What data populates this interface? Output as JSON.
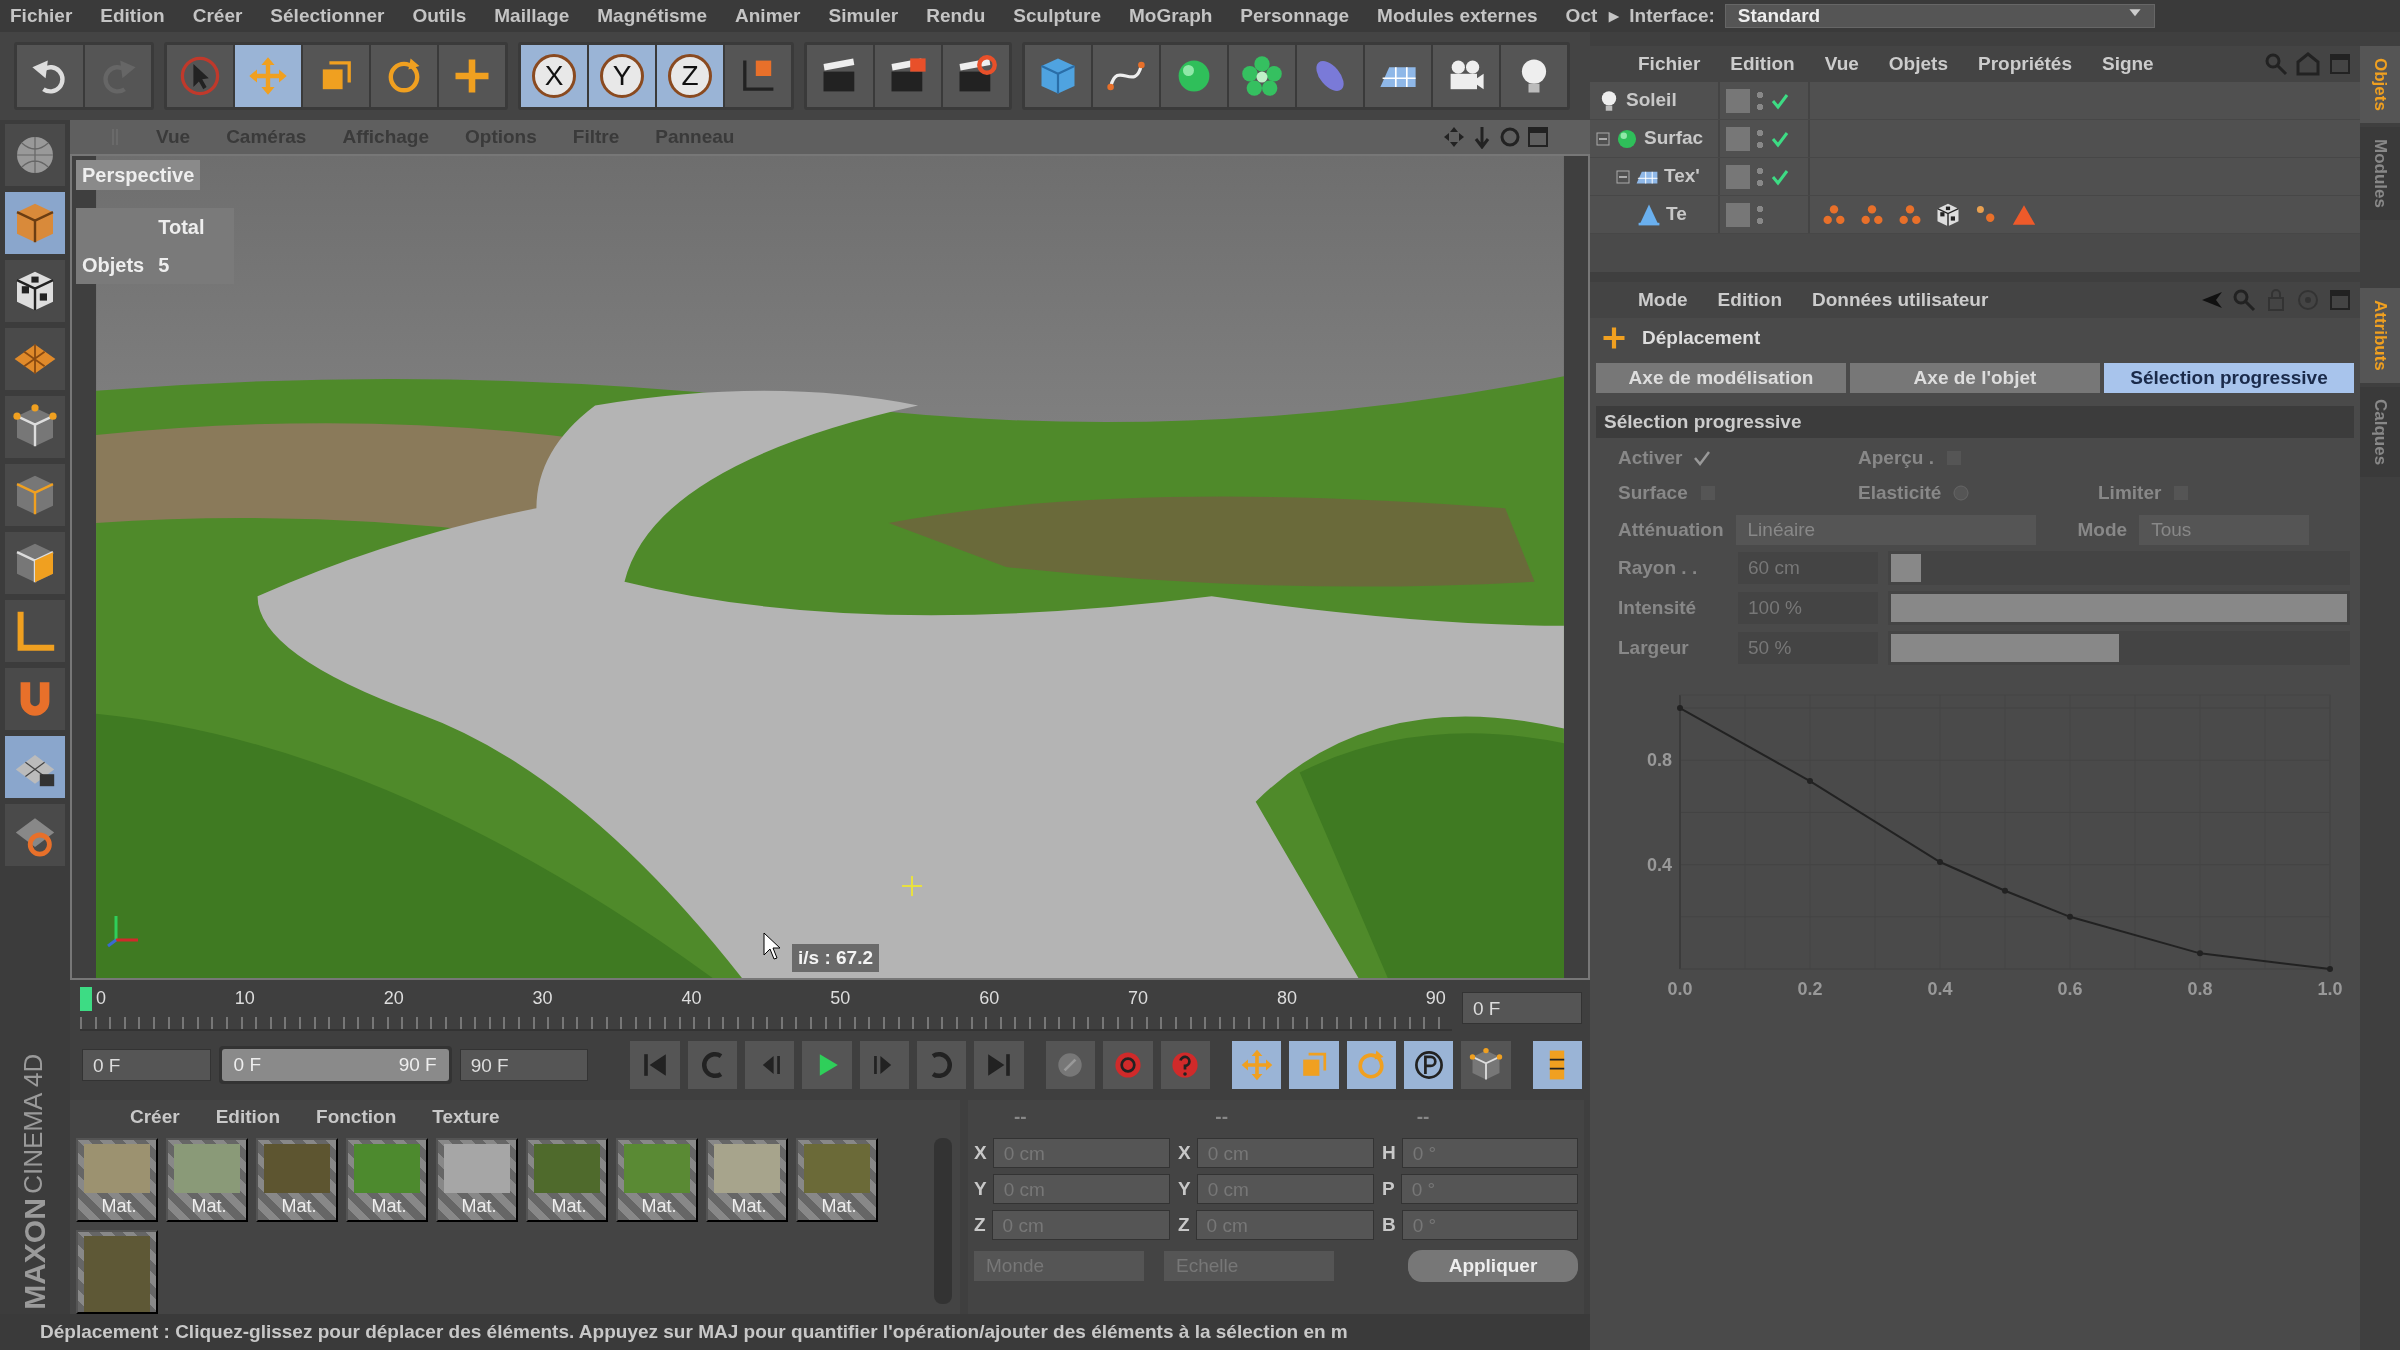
{
  "menu_bar": {
    "items": [
      "Fichier",
      "Edition",
      "Créer",
      "Sélectionner",
      "Outils",
      "Maillage",
      "Magnétisme",
      "Animer",
      "Simuler",
      "Rendu",
      "Sculpture",
      "MoGraph",
      "Personnage",
      "Modules externes",
      "Oct"
    ],
    "arrow": "▸",
    "interface_label": "Interface:",
    "interface_value": "Standard"
  },
  "toolbar": [
    {
      "kind": "undo",
      "selected": false
    },
    {
      "kind": "redo",
      "selected": false
    },
    {
      "kind": "select",
      "selected": false
    },
    {
      "kind": "move",
      "selected": true
    },
    {
      "kind": "scale",
      "selected": false
    },
    {
      "kind": "rotate",
      "selected": false
    },
    {
      "kind": "add",
      "selected": false
    },
    {
      "kind": "axis",
      "label": "X",
      "selected": true
    },
    {
      "kind": "axis",
      "label": "Y",
      "selected": true
    },
    {
      "kind": "axis",
      "label": "Z",
      "selected": true
    },
    {
      "kind": "coords",
      "selected": false
    },
    {
      "kind": "render-view",
      "selected": false
    },
    {
      "kind": "render",
      "selected": false
    },
    {
      "kind": "render-settings",
      "selected": false
    },
    {
      "kind": "cube",
      "selected": false
    },
    {
      "kind": "spline",
      "selected": false
    },
    {
      "kind": "generator",
      "selected": false
    },
    {
      "kind": "cloner",
      "selected": false
    },
    {
      "kind": "deformer",
      "selected": false
    },
    {
      "kind": "floor",
      "selected": false
    },
    {
      "kind": "camera",
      "selected": false
    },
    {
      "kind": "light",
      "selected": false
    }
  ],
  "palette": [
    {
      "kind": "model",
      "selected": false
    },
    {
      "kind": "object",
      "selected": true
    },
    {
      "kind": "texture",
      "selected": false
    },
    {
      "kind": "workplane",
      "selected": false
    },
    {
      "kind": "points",
      "selected": false
    },
    {
      "kind": "edges",
      "selected": false
    },
    {
      "kind": "polygons",
      "selected": false
    },
    {
      "kind": "axis",
      "selected": false
    },
    {
      "kind": "magnet",
      "selected": false
    },
    {
      "kind": "snap",
      "selected": true
    },
    {
      "kind": "snap-rotate",
      "selected": false
    }
  ],
  "logo": [
    "MAXON",
    "CINEMA 4D"
  ],
  "viewport": {
    "menu": [
      "Vue",
      "Caméras",
      "Affichage",
      "Options",
      "Filtre",
      "Panneau"
    ],
    "camera": "Perspective",
    "hud": {
      "header": "Total",
      "label": "Objets",
      "value": "5"
    },
    "fps": "i/s : 67.2"
  },
  "timeline": {
    "ticks": [
      "0",
      "10",
      "20",
      "30",
      "40",
      "50",
      "60",
      "70",
      "80",
      "90"
    ],
    "level": 0,
    "frame": "0 F"
  },
  "transport": {
    "start": "0 F",
    "range": {
      "start": "0 F",
      "end": "90 F",
      "level": 1
    },
    "end": "90 F",
    "buttons": [
      {
        "kind": "first",
        "selected": false
      },
      {
        "kind": "loop-back",
        "selected": false
      },
      {
        "kind": "prev-key",
        "selected": false
      },
      {
        "kind": "play",
        "selected": false
      },
      {
        "kind": "next-key",
        "selected": false
      },
      {
        "kind": "loop",
        "selected": false
      },
      {
        "kind": "last",
        "selected": false
      },
      {
        "kind": "keyframe",
        "selected": false
      },
      {
        "kind": "record",
        "selected": false
      },
      {
        "kind": "autokey",
        "selected": false
      },
      {
        "kind": "move",
        "selected": true
      },
      {
        "kind": "scale",
        "selected": true
      },
      {
        "kind": "rotate",
        "selected": true
      },
      {
        "kind": "param",
        "selected": true
      },
      {
        "kind": "points",
        "selected": false
      },
      {
        "kind": "timeline",
        "selected": true
      }
    ]
  },
  "materials": {
    "menu": [
      "Créer",
      "Edition",
      "Fonction",
      "Texture"
    ],
    "items": [
      {
        "label": "Mat.",
        "color": "#9c9270"
      },
      {
        "label": "Mat.",
        "color": "#8a9a78"
      },
      {
        "label": "Mat.",
        "color": "#5d5530"
      },
      {
        "label": "Mat.",
        "color": "#4d8a2e"
      },
      {
        "label": "Mat.",
        "color": "#a6a6a6"
      },
      {
        "label": "Mat.",
        "color": "#4f6a2c"
      },
      {
        "label": "Mat.",
        "color": "#5a8a34"
      },
      {
        "label": "Mat.",
        "color": "#a7a48c"
      },
      {
        "label": "Mat.",
        "color": "#6b6a38"
      },
      {
        "color": "#5e5836"
      }
    ]
  },
  "coordinates": {
    "disabled": true,
    "headers": [
      "--",
      "--",
      "--"
    ],
    "rows": [
      [
        {
          "axis": "X",
          "value": "0 cm"
        },
        {
          "axis": "X",
          "value": "0 cm"
        },
        {
          "axis": "H",
          "value": "0 °"
        }
      ],
      [
        {
          "axis": "Y",
          "value": "0 cm"
        },
        {
          "axis": "Y",
          "value": "0 cm"
        },
        {
          "axis": "P",
          "value": "0 °"
        }
      ],
      [
        {
          "axis": "Z",
          "value": "0 cm"
        },
        {
          "axis": "Z",
          "value": "0 cm"
        },
        {
          "axis": "B",
          "value": "0 °"
        }
      ]
    ],
    "space": "Monde",
    "mode": "Echelle",
    "apply": "Appliquer"
  },
  "status_bar": "Déplacement : Cliquez-glissez pour déplacer des éléments. Appuyez sur MAJ pour quantifier l'opération/ajouter des éléments à la sélection en m",
  "objects": {
    "menu": [
      "Fichier",
      "Edition",
      "Vue",
      "Objets",
      "Propriétés",
      "Signe"
    ],
    "tree": [
      {
        "name": "Soleil",
        "kind": "light",
        "checked": true
      },
      {
        "name": "Surfac",
        "kind": "generator",
        "checked": true,
        "expanded": true,
        "children": [
          {
            "name": "Tex'",
            "kind": "texture",
            "checked": true,
            "expanded": true,
            "children": [
              {
                "name": "Te",
                "kind": "terrain",
                "checked": false,
                "tags": [
                  {
                    "kind": "vertex-map"
                  },
                  {
                    "kind": "vertex-map"
                  },
                  {
                    "kind": "vertex-map"
                  },
                  {
                    "kind": "texture"
                  },
                  {
                    "kind": "selection"
                  },
                  {
                    "kind": "phong"
                  }
                ]
              }
            ]
          }
        ]
      }
    ]
  },
  "side_tabs_top": [
    {
      "label": "Objets",
      "selected": true
    },
    {
      "label": "Modules",
      "selected": false
    }
  ],
  "side_tabs_bottom": [
    {
      "label": "Attributs",
      "selected": true
    },
    {
      "label": "Calques",
      "selected": false
    }
  ],
  "attributes": {
    "menu": [
      "Mode",
      "Edition",
      "Données utilisateur"
    ],
    "title": "Déplacement",
    "tabs": [
      {
        "label": "Axe de modélisation",
        "selected": false
      },
      {
        "label": "Axe de l'objet",
        "selected": false
      },
      {
        "label": "Sélection progressive",
        "selected": true
      }
    ],
    "section": "Sélection progressive",
    "options": [
      [
        {
          "label": "Activer",
          "kind": "check",
          "checked": true
        },
        {
          "label": "Aperçu .",
          "kind": "checkbox",
          "checked": false
        }
      ],
      [
        {
          "label": "Surface",
          "kind": "checkbox",
          "checked": false
        },
        {
          "label": "Elasticité",
          "kind": "radio",
          "checked": false
        },
        {
          "label": "Limiter",
          "kind": "checkbox",
          "checked": false
        }
      ]
    ],
    "falloff": {
      "label": "Atténuation",
      "value": "Linéaire",
      "mode_label": "Mode",
      "mode_value": "Tous"
    },
    "sliders": [
      {
        "label": "Rayon . .",
        "value": "60 cm",
        "level": 0.06
      },
      {
        "label": "Intensité",
        "value": "100 %",
        "level": 1
      },
      {
        "label": "Largeur",
        "value": "50 %",
        "level": 0.5
      }
    ],
    "chart_data": {
      "type": "line",
      "marker": true,
      "x": [
        0,
        0.2,
        0.4,
        0.5,
        0.6,
        0.8,
        1
      ],
      "values": [
        1,
        0.72,
        0.41,
        0.3,
        0.2,
        0.06,
        0
      ],
      "xlim": [
        0,
        1
      ],
      "ylim": [
        0,
        1.05
      ],
      "xticks": [
        {
          "value": 0,
          "label": "0.0"
        },
        {
          "value": 0.2,
          "label": "0.2"
        },
        {
          "value": 0.4,
          "label": "0.4"
        },
        {
          "value": 0.6,
          "label": "0.6"
        },
        {
          "value": 0.8,
          "label": "0.8"
        },
        {
          "value": 1,
          "label": "1.0"
        }
      ],
      "yticks": [
        {
          "value": 0.4,
          "label": "0.4"
        },
        {
          "value": 0.8,
          "label": "0.8"
        }
      ]
    }
  }
}
